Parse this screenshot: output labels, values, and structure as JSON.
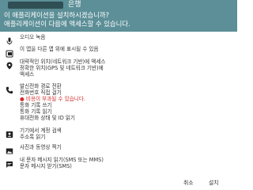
{
  "header": {
    "app_name": "은행",
    "question_line1": "이 애플리케이션을 설치하시겠습니까?",
    "question_line2": "애플리케이션이 다음에 액세스할 수 있습니다."
  },
  "permissions": [
    {
      "icon": "microphone-icon",
      "lines": [
        "오디오 녹음"
      ]
    },
    {
      "icon": "overlay-icon",
      "lines": [
        "이 앱을 다른 앱 위에 표시될 수 있음"
      ]
    },
    {
      "icon": "location-pin-icon",
      "lines": [
        "대략적인 위치(네트워크 기반)에 액세스",
        "정확한 위치(GPS 및 네트워크 기반)에",
        "액세스"
      ]
    },
    {
      "icon": "phone-icon",
      "lines": [
        "발신전화 경로 전환",
        "전화번호 직접 걸기"
      ],
      "warning": "비용이 부과될 수 있습니다.",
      "lines_after": [
        "통화 기록 쓰기",
        "통화 기록 읽기",
        "휴대전화 상태 및 ID 읽기"
      ]
    },
    {
      "icon": "contacts-icon",
      "lines": [
        "기기에서 계정 검색",
        "주소록 읽기"
      ]
    },
    {
      "icon": "image-icon",
      "lines": [
        "사진과 동영상 찍기"
      ]
    },
    {
      "icon": "message-icon",
      "lines": [
        "내 문자 메시지 읽기(SMS 또는 MMS)",
        "문자 메시지 받기(SMS)"
      ]
    }
  ],
  "footer": {
    "cancel_label": "취소",
    "install_label": "설치"
  }
}
